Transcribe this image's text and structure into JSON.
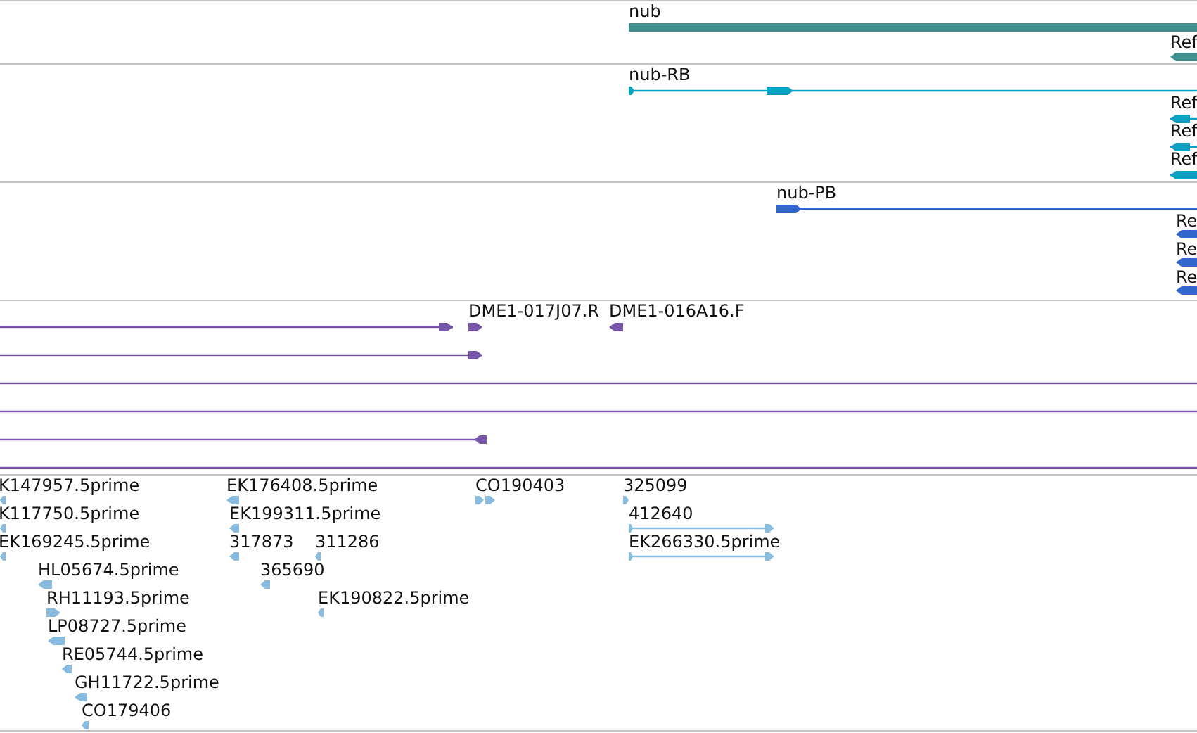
{
  "tracks": [
    {
      "kind": "gene",
      "features": [
        {
          "label": "nub"
        },
        {
          "label": "Ref"
        }
      ]
    },
    {
      "kind": "transcript",
      "features": [
        {
          "label": "nub-RB"
        },
        {
          "label": "Ref"
        },
        {
          "label": "Ref"
        },
        {
          "label": "Ref"
        }
      ]
    },
    {
      "kind": "protein",
      "features": [
        {
          "label": "nub-PB"
        },
        {
          "label": "Re"
        },
        {
          "label": "Re"
        },
        {
          "label": "Re"
        }
      ]
    },
    {
      "kind": "clone",
      "features": [
        {
          "label": "DME1-017J07.R"
        },
        {
          "label": "DME1-016A16.F"
        }
      ]
    },
    {
      "kind": "est",
      "features": [
        {
          "label": "K147957.5prime"
        },
        {
          "label": "K117750.5prime"
        },
        {
          "label": "EK169245.5prime"
        },
        {
          "label": "HL05674.5prime"
        },
        {
          "label": "RH11193.5prime"
        },
        {
          "label": "LP08727.5prime"
        },
        {
          "label": "RE05744.5prime"
        },
        {
          "label": "GH11722.5prime"
        },
        {
          "label": "CO179406"
        },
        {
          "label": "EK176408.5prime"
        },
        {
          "label": "EK199311.5prime"
        },
        {
          "label": "317873"
        },
        {
          "label": "311286"
        },
        {
          "label": "365690"
        },
        {
          "label": "EK190822.5prime"
        },
        {
          "label": "CO190403"
        },
        {
          "label": "325099"
        },
        {
          "label": "412640"
        },
        {
          "label": "EK266330.5prime"
        }
      ]
    }
  ]
}
